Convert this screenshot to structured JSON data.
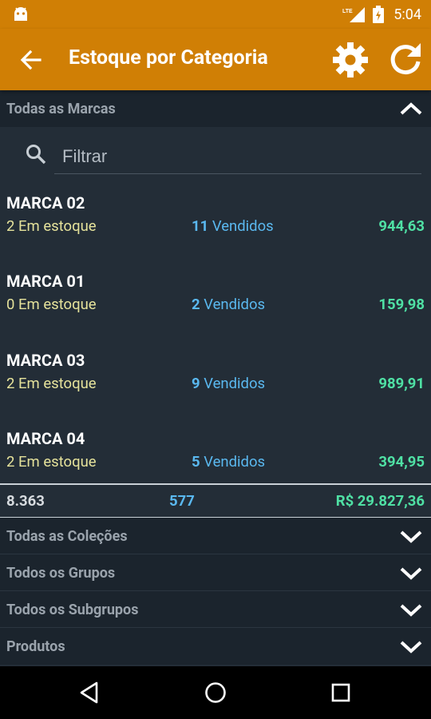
{
  "status_bar": {
    "time": "5:04",
    "network_label": "LTE",
    "icons": [
      "android-icon",
      "lte-signal-icon",
      "battery-icon"
    ]
  },
  "appbar": {
    "title": "Estoque por Categoria",
    "icons": [
      "back-arrow-icon",
      "gear-icon",
      "refresh-icon"
    ],
    "color": "#d07f05"
  },
  "brands_section": {
    "label": "Todas as Marcas",
    "expanded": true
  },
  "filter": {
    "placeholder": "Filtrar",
    "value": ""
  },
  "items": [
    {
      "name": "MARCA 02",
      "stock": "2 Em estoque",
      "sold_count": "11",
      "sold_label": "Vendidos",
      "value": "944,63"
    },
    {
      "name": "MARCA 01",
      "stock": "0 Em estoque",
      "sold_count": "2",
      "sold_label": "Vendidos",
      "value": "159,98"
    },
    {
      "name": "MARCA 03",
      "stock": "2 Em estoque",
      "sold_count": "9",
      "sold_label": "Vendidos",
      "value": "989,91"
    },
    {
      "name": "MARCA 04",
      "stock": "2 Em estoque",
      "sold_count": "5",
      "sold_label": "Vendidos",
      "value": "394,95"
    }
  ],
  "totals": {
    "stock": "8.363",
    "sold": "577",
    "value": "R$ 29.827,36"
  },
  "collapsed_sections": [
    {
      "label": "Todas as Coleções"
    },
    {
      "label": "Todos os Grupos"
    },
    {
      "label": "Todos os Subgrupos"
    },
    {
      "label": "Produtos"
    }
  ],
  "nav_bar": {
    "icons": [
      "back-triangle-icon",
      "home-circle-icon",
      "recents-square-icon"
    ]
  },
  "colors": {
    "background": "#232d37",
    "section_header": "#1b242d",
    "stock_text": "#e5e29b",
    "sold_text": "#5ab8ef",
    "value_text": "#4fe0a4"
  }
}
